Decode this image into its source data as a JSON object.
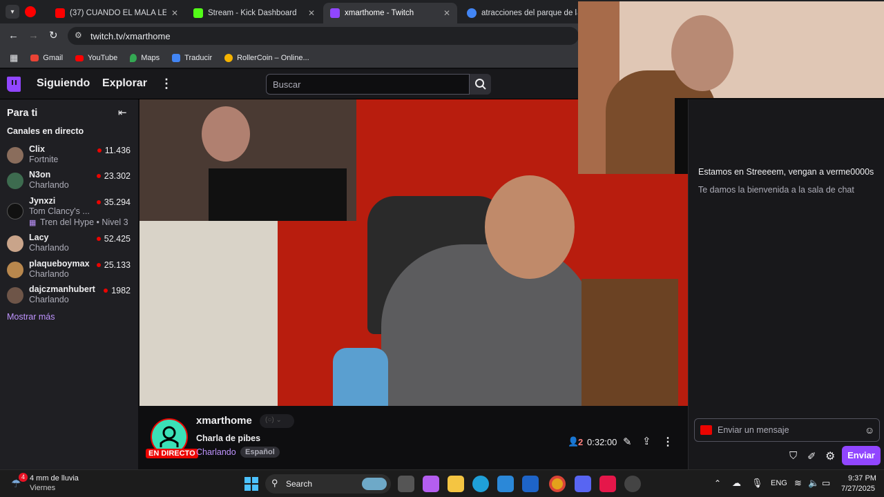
{
  "browser": {
    "tabs": [
      {
        "label": "(37) CUANDO EL MALA LECHE",
        "color": "#ff0000"
      },
      {
        "label": "Stream - Kick Dashboard",
        "color": "#53fc18"
      },
      {
        "label": "xmarthome - Twitch",
        "color": "#9146ff"
      },
      {
        "label": "atracciones del parque de la co",
        "color": "#4285f4"
      }
    ],
    "url": "twitch.tv/xmarthome",
    "bookmarks": [
      "Gmail",
      "YouTube",
      "Maps",
      "Traducir",
      "RollerCoin – Online..."
    ]
  },
  "nav": {
    "following": "Siguiendo",
    "browse": "Explorar",
    "search_placeholder": "Buscar"
  },
  "sidebar": {
    "title": "Para ti",
    "section": "Canales en directo",
    "show_more": "Mostrar más",
    "channels": [
      {
        "name": "Clix",
        "category": "Fortnite",
        "viewers": "11.436",
        "color": "#8a6d5c"
      },
      {
        "name": "N3on",
        "category": "Charlando",
        "viewers": "23.302",
        "color": "#3d6b4f"
      },
      {
        "name": "Jynxzi",
        "category": "Tom Clancy's ...",
        "viewers": "35.294",
        "extra": "Tren del Hype • Nivel 3",
        "color": "#eeeeee"
      },
      {
        "name": "Lacy",
        "category": "Charlando",
        "viewers": "52.425",
        "color": "#c9a48a"
      },
      {
        "name": "plaqueboymax",
        "category": "Charlando",
        "viewers": "25.133",
        "color": "#b8874d"
      },
      {
        "name": "dajczmanhubert",
        "category": "Charlando",
        "viewers": "1982",
        "color": "#6e5548"
      }
    ]
  },
  "stream": {
    "channel": "xmarthome",
    "title": "Charla de pibes",
    "category": "Charlando",
    "tag": "Español",
    "live_badge": "EN DIRECTO",
    "viewers": "2",
    "uptime": "0:32:00"
  },
  "chat": {
    "partial_message": "Estamos en Streeeem, vengan a verme0000s",
    "welcome": "Te damos la bienvenida a la sala de chat",
    "input_placeholder": "Enviar un mensaje",
    "send": "Enviar"
  },
  "taskbar": {
    "weather": "4 mm de lluvia",
    "weather_day": "Viernes",
    "weather_badge": "4",
    "search": "Search",
    "lang": "ENG",
    "time": "9:37 PM",
    "date": "7/27/2025"
  }
}
